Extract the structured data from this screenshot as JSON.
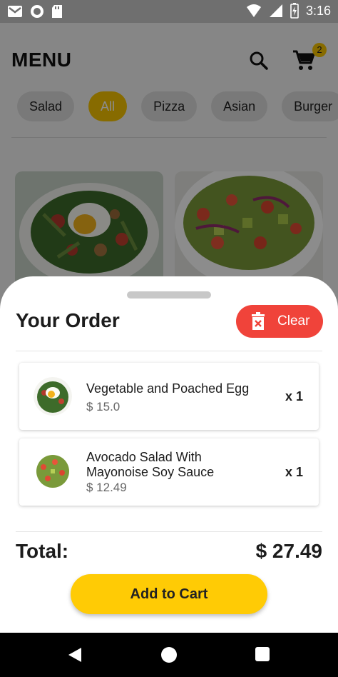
{
  "status_bar": {
    "time": "3:16",
    "icons": [
      "gmail-icon",
      "record-icon",
      "sd-card-icon",
      "wifi-icon",
      "signal-icon",
      "battery-icon"
    ]
  },
  "header": {
    "title": "MENU",
    "search_icon": "search-icon",
    "cart_icon": "cart-icon",
    "cart_count": "2"
  },
  "categories": [
    "Salad",
    "All",
    "Pizza",
    "Asian",
    "Burger"
  ],
  "active_category": "All",
  "food_cards": [
    {
      "image": "vegetable-poached-egg-salad"
    },
    {
      "image": "avocado-salad"
    }
  ],
  "order_sheet": {
    "title": "Your Order",
    "clear_label": "Clear",
    "items": [
      {
        "name": "Vegetable and Poached Egg",
        "price": "$ 15.0",
        "qty": "x 1"
      },
      {
        "name": "Avocado Salad With Mayonoise Soy Sauce",
        "price": "$ 12.49",
        "qty": "x 1"
      }
    ],
    "total_label": "Total:",
    "total_value": "$ 27.49",
    "add_to_cart_label": "Add to Cart"
  },
  "colors": {
    "accent": "#ffcb05",
    "clear": "#f0433a",
    "chip_active": "#f6c400"
  }
}
